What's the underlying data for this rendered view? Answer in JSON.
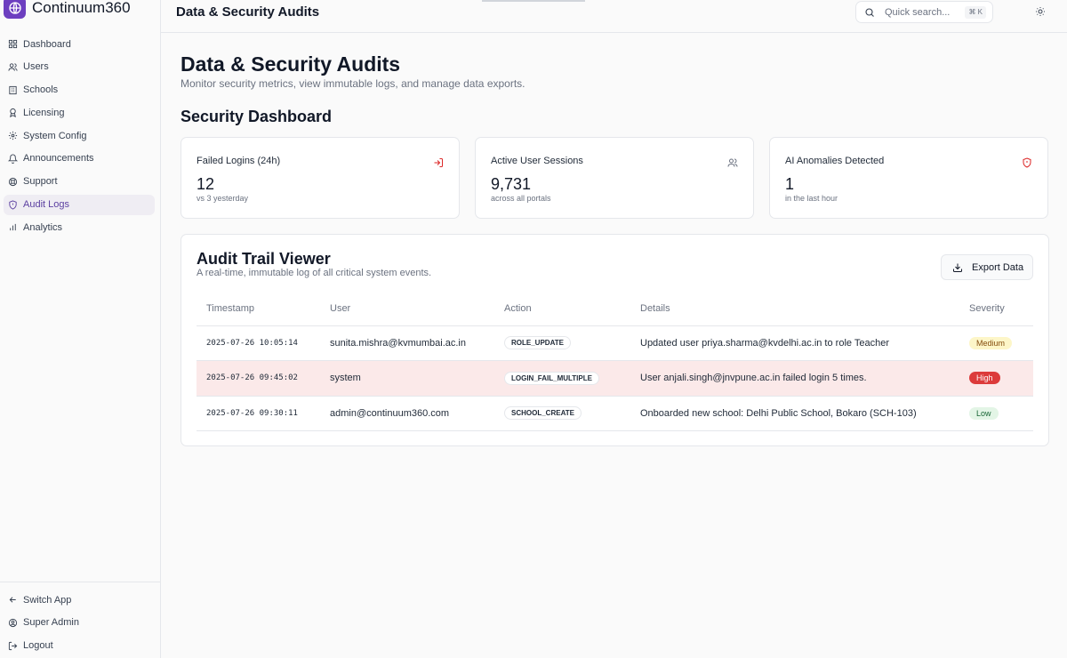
{
  "app": {
    "name": "Continuum360",
    "brand_color": "#6d3fc0"
  },
  "sidebar": {
    "items": [
      {
        "label": "Dashboard",
        "icon": "layout-grid-icon"
      },
      {
        "label": "Users",
        "icon": "users-icon"
      },
      {
        "label": "Schools",
        "icon": "building-icon"
      },
      {
        "label": "Licensing",
        "icon": "award-icon"
      },
      {
        "label": "System Config",
        "icon": "gear-icon"
      },
      {
        "label": "Announcements",
        "icon": "bell-icon"
      },
      {
        "label": "Support",
        "icon": "lifebuoy-icon"
      },
      {
        "label": "Audit Logs",
        "icon": "shield-icon",
        "active": true
      },
      {
        "label": "Analytics",
        "icon": "bar-chart-icon"
      }
    ],
    "bottom": [
      {
        "label": "Switch App",
        "icon": "arrow-left-icon"
      },
      {
        "label": "Super Admin",
        "icon": "user-circle-icon"
      },
      {
        "label": "Logout",
        "icon": "logout-icon"
      }
    ]
  },
  "header": {
    "title": "Data & Security Audits",
    "search_placeholder": "Quick search...",
    "search_shortcut": "⌘ K"
  },
  "page": {
    "title": "Data & Security Audits",
    "subtitle": "Monitor security metrics, view immutable logs, and manage data exports.",
    "section_title": "Security Dashboard"
  },
  "stats": [
    {
      "label": "Failed Logins (24h)",
      "value": "12",
      "sub": "vs 3 yesterday",
      "icon": "login-icon",
      "icon_color": "#dc2626"
    },
    {
      "label": "Active User Sessions",
      "value": "9,731",
      "sub": "across all portals",
      "icon": "users-icon",
      "icon_color": "#6b7280"
    },
    {
      "label": "AI Anomalies Detected",
      "value": "1",
      "sub": "in the last hour",
      "icon": "shield-alert-icon",
      "icon_color": "#dc2626"
    }
  ],
  "audit": {
    "title": "Audit Trail Viewer",
    "subtitle": "A real-time, immutable log of all critical system events.",
    "export_label": "Export Data",
    "columns": [
      "Timestamp",
      "User",
      "Action",
      "Details",
      "Severity"
    ],
    "rows": [
      {
        "timestamp": "2025-07-26 10:05:14",
        "user": "sunita.mishra@kvmumbai.ac.in",
        "action": "ROLE_UPDATE",
        "details": "Updated user priya.sharma@kvdelhi.ac.in to role Teacher",
        "severity": "Medium"
      },
      {
        "timestamp": "2025-07-26 09:45:02",
        "user": "system",
        "action": "LOGIN_FAIL_MULTIPLE",
        "details": "User anjali.singh@jnvpune.ac.in failed login 5 times.",
        "severity": "High"
      },
      {
        "timestamp": "2025-07-26 09:30:11",
        "user": "admin@continuum360.com",
        "action": "SCHOOL_CREATE",
        "details": "Onboarded new school: Delhi Public School, Bokaro (SCH-103)",
        "severity": "Low"
      }
    ]
  }
}
